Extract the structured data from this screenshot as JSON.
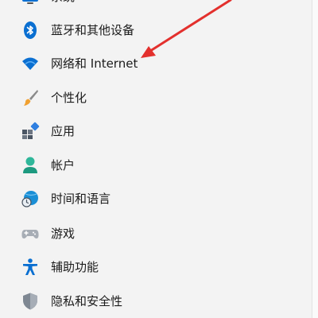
{
  "sidebar": {
    "items": [
      {
        "label": "系统",
        "icon": "system-icon"
      },
      {
        "label": "蓝牙和其他设备",
        "icon": "bluetooth-icon"
      },
      {
        "label": "网络和 Internet",
        "icon": "wifi-icon"
      },
      {
        "label": "个性化",
        "icon": "brush-icon"
      },
      {
        "label": "应用",
        "icon": "apps-icon"
      },
      {
        "label": "帐户",
        "icon": "account-icon"
      },
      {
        "label": "时间和语言",
        "icon": "time-language-icon"
      },
      {
        "label": "游戏",
        "icon": "gamepad-icon"
      },
      {
        "label": "辅助功能",
        "icon": "accessibility-icon"
      },
      {
        "label": "隐私和安全性",
        "icon": "shield-icon"
      }
    ]
  },
  "annotation": {
    "arrow_color": "#e3302d",
    "points_to": "网络和 Internet"
  },
  "colors": {
    "accent": "#0067c0",
    "background": "#f3f3f3"
  }
}
